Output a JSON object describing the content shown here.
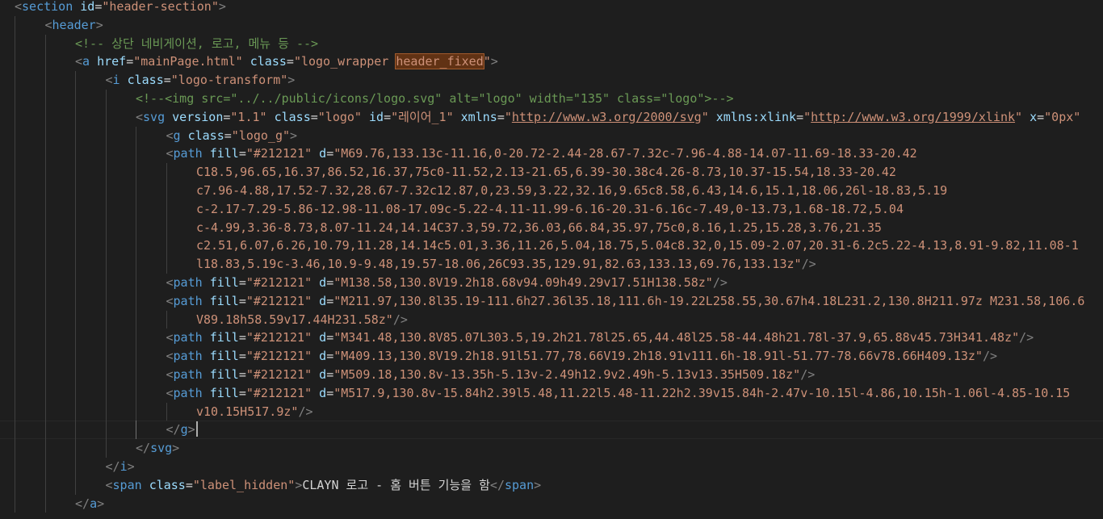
{
  "editor": {
    "lines": [
      {
        "indent": 0,
        "tokens": [
          {
            "t": "punct",
            "v": "<"
          },
          {
            "t": "tag",
            "v": "section"
          },
          {
            "t": "text",
            "v": " "
          },
          {
            "t": "attr",
            "v": "id"
          },
          {
            "t": "eq",
            "v": "="
          },
          {
            "t": "str",
            "v": "\"header-section\""
          },
          {
            "t": "punct",
            "v": ">"
          }
        ]
      },
      {
        "indent": 1,
        "tokens": [
          {
            "t": "punct",
            "v": "<"
          },
          {
            "t": "tag",
            "v": "header"
          },
          {
            "t": "punct",
            "v": ">"
          }
        ]
      },
      {
        "indent": 2,
        "tokens": [
          {
            "t": "comment",
            "v": "<!-- 상단 네비게이션, 로고, 메뉴 등 -->"
          }
        ]
      },
      {
        "indent": 2,
        "tokens": [
          {
            "t": "punct",
            "v": "<"
          },
          {
            "t": "tag",
            "v": "a"
          },
          {
            "t": "text",
            "v": " "
          },
          {
            "t": "attr",
            "v": "href"
          },
          {
            "t": "eq",
            "v": "="
          },
          {
            "t": "str",
            "v": "\"mainPage.html\""
          },
          {
            "t": "text",
            "v": " "
          },
          {
            "t": "attr",
            "v": "class"
          },
          {
            "t": "eq",
            "v": "="
          },
          {
            "t": "str",
            "v": "\"logo_wrapper "
          },
          {
            "t": "str hl",
            "v": "header_fixed"
          },
          {
            "t": "str",
            "v": "\""
          },
          {
            "t": "punct",
            "v": ">"
          }
        ]
      },
      {
        "indent": 3,
        "tokens": [
          {
            "t": "punct",
            "v": "<"
          },
          {
            "t": "tag",
            "v": "i"
          },
          {
            "t": "text",
            "v": " "
          },
          {
            "t": "attr",
            "v": "class"
          },
          {
            "t": "eq",
            "v": "="
          },
          {
            "t": "str",
            "v": "\"logo-transform\""
          },
          {
            "t": "punct",
            "v": ">"
          }
        ]
      },
      {
        "indent": 4,
        "tokens": [
          {
            "t": "comment",
            "v": "<!--<img src=\"../../public/icons/logo.svg\" alt=\"logo\" width=\"135\" class=\"logo\">-->"
          }
        ]
      },
      {
        "indent": 4,
        "tokens": [
          {
            "t": "punct",
            "v": "<"
          },
          {
            "t": "tag",
            "v": "svg"
          },
          {
            "t": "text",
            "v": " "
          },
          {
            "t": "attr",
            "v": "version"
          },
          {
            "t": "eq",
            "v": "="
          },
          {
            "t": "str",
            "v": "\"1.1\""
          },
          {
            "t": "text",
            "v": " "
          },
          {
            "t": "attr",
            "v": "class"
          },
          {
            "t": "eq",
            "v": "="
          },
          {
            "t": "str",
            "v": "\"logo\""
          },
          {
            "t": "text",
            "v": " "
          },
          {
            "t": "attr",
            "v": "id"
          },
          {
            "t": "eq",
            "v": "="
          },
          {
            "t": "str",
            "v": "\"레이어_1\""
          },
          {
            "t": "text",
            "v": " "
          },
          {
            "t": "attr",
            "v": "xmlns"
          },
          {
            "t": "eq",
            "v": "="
          },
          {
            "t": "str",
            "v": "\""
          },
          {
            "t": "str link",
            "v": "http://www.w3.org/2000/svg"
          },
          {
            "t": "str",
            "v": "\""
          },
          {
            "t": "text",
            "v": " "
          },
          {
            "t": "attr",
            "v": "xmlns:xlink"
          },
          {
            "t": "eq",
            "v": "="
          },
          {
            "t": "str",
            "v": "\""
          },
          {
            "t": "str link",
            "v": "http://www.w3.org/1999/xlink"
          },
          {
            "t": "str",
            "v": "\""
          },
          {
            "t": "text",
            "v": " "
          },
          {
            "t": "attr",
            "v": "x"
          },
          {
            "t": "eq",
            "v": "="
          },
          {
            "t": "str",
            "v": "\"0px\""
          }
        ]
      },
      {
        "indent": 5,
        "tokens": [
          {
            "t": "punct",
            "v": "<"
          },
          {
            "t": "tag",
            "v": "g"
          },
          {
            "t": "text",
            "v": " "
          },
          {
            "t": "attr",
            "v": "class"
          },
          {
            "t": "eq",
            "v": "="
          },
          {
            "t": "str",
            "v": "\"logo_g\""
          },
          {
            "t": "punct",
            "v": ">"
          }
        ]
      },
      {
        "indent": 5,
        "tokens": [
          {
            "t": "punct",
            "v": "<"
          },
          {
            "t": "tag",
            "v": "path"
          },
          {
            "t": "text",
            "v": " "
          },
          {
            "t": "attr",
            "v": "fill"
          },
          {
            "t": "eq",
            "v": "="
          },
          {
            "t": "str",
            "v": "\"#212121\""
          },
          {
            "t": "text",
            "v": " "
          },
          {
            "t": "attr",
            "v": "d"
          },
          {
            "t": "eq",
            "v": "="
          },
          {
            "t": "str",
            "v": "\"M69.76,133.13c-11.16,0-20.72-2.44-28.67-7.32c-7.96-4.88-14.07-11.69-18.33-20.42"
          }
        ]
      },
      {
        "indent": 6,
        "tokens": [
          {
            "t": "str",
            "v": "C18.5,96.65,16.37,86.52,16.37,75c0-11.52,2.13-21.65,6.39-30.38c4.26-8.73,10.37-15.54,18.33-20.42"
          }
        ]
      },
      {
        "indent": 6,
        "tokens": [
          {
            "t": "str",
            "v": "c7.96-4.88,17.52-7.32,28.67-7.32c12.87,0,23.59,3.22,32.16,9.65c8.58,6.43,14.6,15.1,18.06,26l-18.83,5.19"
          }
        ]
      },
      {
        "indent": 6,
        "tokens": [
          {
            "t": "str",
            "v": "c-2.17-7.29-5.86-12.98-11.08-17.09c-5.22-4.11-11.99-6.16-20.31-6.16c-7.49,0-13.73,1.68-18.72,5.04"
          }
        ]
      },
      {
        "indent": 6,
        "tokens": [
          {
            "t": "str",
            "v": "c-4.99,3.36-8.73,8.07-11.24,14.14C37.3,59.72,36.03,66.84,35.97,75c0,8.16,1.25,15.28,3.76,21.35"
          }
        ]
      },
      {
        "indent": 6,
        "tokens": [
          {
            "t": "str",
            "v": "c2.51,6.07,6.26,10.79,11.28,14.14c5.01,3.36,11.26,5.04,18.75,5.04c8.32,0,15.09-2.07,20.31-6.2c5.22-4.13,8.91-9.82,11.08-1"
          }
        ]
      },
      {
        "indent": 6,
        "tokens": [
          {
            "t": "str",
            "v": "l18.83,5.19c-3.46,10.9-9.48,19.57-18.06,26C93.35,129.91,82.63,133.13,69.76,133.13z\""
          },
          {
            "t": "punct",
            "v": "/>"
          }
        ]
      },
      {
        "indent": 5,
        "tokens": [
          {
            "t": "punct",
            "v": "<"
          },
          {
            "t": "tag",
            "v": "path"
          },
          {
            "t": "text",
            "v": " "
          },
          {
            "t": "attr",
            "v": "fill"
          },
          {
            "t": "eq",
            "v": "="
          },
          {
            "t": "str",
            "v": "\"#212121\""
          },
          {
            "t": "text",
            "v": " "
          },
          {
            "t": "attr",
            "v": "d"
          },
          {
            "t": "eq",
            "v": "="
          },
          {
            "t": "str",
            "v": "\"M138.58,130.8V19.2h18.68v94.09h49.29v17.51H138.58z\""
          },
          {
            "t": "punct",
            "v": "/>"
          }
        ]
      },
      {
        "indent": 5,
        "tokens": [
          {
            "t": "punct",
            "v": "<"
          },
          {
            "t": "tag",
            "v": "path"
          },
          {
            "t": "text",
            "v": " "
          },
          {
            "t": "attr",
            "v": "fill"
          },
          {
            "t": "eq",
            "v": "="
          },
          {
            "t": "str",
            "v": "\"#212121\""
          },
          {
            "t": "text",
            "v": " "
          },
          {
            "t": "attr",
            "v": "d"
          },
          {
            "t": "eq",
            "v": "="
          },
          {
            "t": "str",
            "v": "\"M211.97,130.8l35.19-111.6h27.36l35.18,111.6h-19.22L258.55,30.67h4.18L231.2,130.8H211.97z M231.58,106.6"
          }
        ]
      },
      {
        "indent": 6,
        "tokens": [
          {
            "t": "str",
            "v": "V89.18h58.59v17.44H231.58z\""
          },
          {
            "t": "punct",
            "v": "/>"
          }
        ]
      },
      {
        "indent": 5,
        "tokens": [
          {
            "t": "punct",
            "v": "<"
          },
          {
            "t": "tag",
            "v": "path"
          },
          {
            "t": "text",
            "v": " "
          },
          {
            "t": "attr",
            "v": "fill"
          },
          {
            "t": "eq",
            "v": "="
          },
          {
            "t": "str",
            "v": "\"#212121\""
          },
          {
            "t": "text",
            "v": " "
          },
          {
            "t": "attr",
            "v": "d"
          },
          {
            "t": "eq",
            "v": "="
          },
          {
            "t": "str",
            "v": "\"M341.48,130.8V85.07L303.5,19.2h21.78l25.65,44.48l25.58-44.48h21.78l-37.9,65.88v45.73H341.48z\""
          },
          {
            "t": "punct",
            "v": "/>"
          }
        ]
      },
      {
        "indent": 5,
        "tokens": [
          {
            "t": "punct",
            "v": "<"
          },
          {
            "t": "tag",
            "v": "path"
          },
          {
            "t": "text",
            "v": " "
          },
          {
            "t": "attr",
            "v": "fill"
          },
          {
            "t": "eq",
            "v": "="
          },
          {
            "t": "str",
            "v": "\"#212121\""
          },
          {
            "t": "text",
            "v": " "
          },
          {
            "t": "attr",
            "v": "d"
          },
          {
            "t": "eq",
            "v": "="
          },
          {
            "t": "str",
            "v": "\"M409.13,130.8V19.2h18.91l51.77,78.66V19.2h18.91v111.6h-18.91l-51.77-78.66v78.66H409.13z\""
          },
          {
            "t": "punct",
            "v": "/>"
          }
        ]
      },
      {
        "indent": 5,
        "tokens": [
          {
            "t": "punct",
            "v": "<"
          },
          {
            "t": "tag",
            "v": "path"
          },
          {
            "t": "text",
            "v": " "
          },
          {
            "t": "attr",
            "v": "fill"
          },
          {
            "t": "eq",
            "v": "="
          },
          {
            "t": "str",
            "v": "\"#212121\""
          },
          {
            "t": "text",
            "v": " "
          },
          {
            "t": "attr",
            "v": "d"
          },
          {
            "t": "eq",
            "v": "="
          },
          {
            "t": "str",
            "v": "\"M509.18,130.8v-13.35h-5.13v-2.49h12.9v2.49h-5.13v13.35H509.18z\""
          },
          {
            "t": "punct",
            "v": "/>"
          }
        ]
      },
      {
        "indent": 5,
        "tokens": [
          {
            "t": "punct",
            "v": "<"
          },
          {
            "t": "tag",
            "v": "path"
          },
          {
            "t": "text",
            "v": " "
          },
          {
            "t": "attr",
            "v": "fill"
          },
          {
            "t": "eq",
            "v": "="
          },
          {
            "t": "str",
            "v": "\"#212121\""
          },
          {
            "t": "text",
            "v": " "
          },
          {
            "t": "attr",
            "v": "d"
          },
          {
            "t": "eq",
            "v": "="
          },
          {
            "t": "str",
            "v": "\"M517.9,130.8v-15.84h2.39l5.48,11.22l5.48-11.22h2.39v15.84h-2.47v-10.15l-4.86,10.15h-1.06l-4.85-10.15"
          }
        ]
      },
      {
        "indent": 6,
        "tokens": [
          {
            "t": "str",
            "v": "v10.15H517.9z\""
          },
          {
            "t": "punct",
            "v": "/>"
          }
        ]
      },
      {
        "indent": 5,
        "current": true,
        "tokens": [
          {
            "t": "punct",
            "v": "</"
          },
          {
            "t": "tag",
            "v": "g"
          },
          {
            "t": "punct",
            "v": ">"
          }
        ]
      },
      {
        "indent": 4,
        "tokens": [
          {
            "t": "punct",
            "v": "</"
          },
          {
            "t": "tag",
            "v": "svg"
          },
          {
            "t": "punct",
            "v": ">"
          }
        ]
      },
      {
        "indent": 3,
        "tokens": [
          {
            "t": "punct",
            "v": "</"
          },
          {
            "t": "tag",
            "v": "i"
          },
          {
            "t": "punct",
            "v": ">"
          }
        ]
      },
      {
        "indent": 3,
        "tokens": [
          {
            "t": "punct",
            "v": "<"
          },
          {
            "t": "tag",
            "v": "span"
          },
          {
            "t": "text",
            "v": " "
          },
          {
            "t": "attr",
            "v": "class"
          },
          {
            "t": "eq",
            "v": "="
          },
          {
            "t": "str",
            "v": "\"label_hidden\""
          },
          {
            "t": "punct",
            "v": ">"
          },
          {
            "t": "text",
            "v": "CLAYN 로고 - 홈 버튼 기능을 함"
          },
          {
            "t": "punct",
            "v": "</"
          },
          {
            "t": "tag",
            "v": "span"
          },
          {
            "t": "punct",
            "v": ">"
          }
        ]
      },
      {
        "indent": 2,
        "tokens": [
          {
            "t": "punct",
            "v": "</"
          },
          {
            "t": "tag",
            "v": "a"
          },
          {
            "t": "punct",
            "v": ">"
          }
        ]
      }
    ],
    "colors": {
      "background": "#1e1e1e",
      "tag": "#569cd6",
      "attribute": "#9cdcfe",
      "string": "#ce9178",
      "comment": "#6a9955",
      "punctuation": "#808080",
      "text": "#d4d4d4",
      "find_highlight": "#613214"
    }
  }
}
